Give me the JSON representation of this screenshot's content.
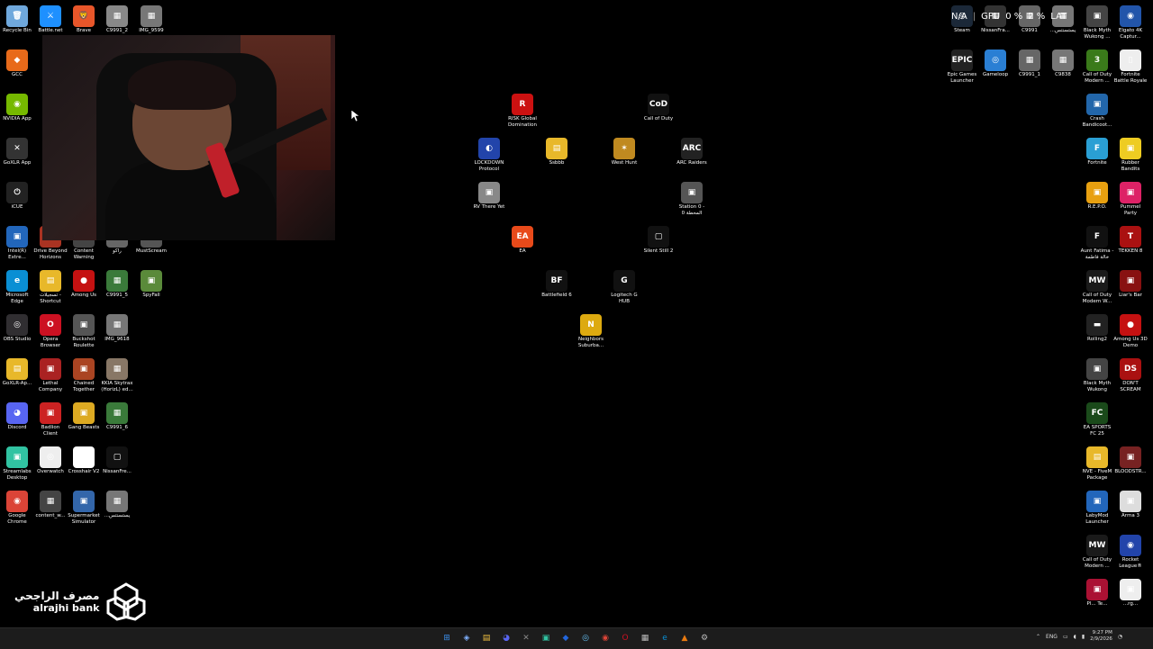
{
  "desktop": {
    "left_icons": [
      {
        "label": "Recycle Bin",
        "color": "#6fa8dc",
        "glyph": "🗑"
      },
      {
        "label": "Battle.net",
        "color": "#1e90ff",
        "glyph": "⚔"
      },
      {
        "label": "Brave",
        "color": "#e8562a",
        "glyph": "🦁"
      },
      {
        "label": "C9991_2",
        "color": "#888",
        "glyph": "▦"
      },
      {
        "label": "IMG_9599",
        "color": "#777",
        "glyph": "▦"
      },
      {
        "label": "GCC",
        "color": "#e86a1a",
        "glyph": "◆"
      },
      {
        "label": "NVIDIA App",
        "color": "#76b900",
        "glyph": "◉"
      },
      {
        "label": "GoXLR App",
        "color": "#333",
        "glyph": "✕"
      },
      {
        "label": "iCUE",
        "color": "#222",
        "glyph": "⏻"
      },
      {
        "label": "Intel(R) Extre...",
        "color": "#2266bb",
        "glyph": "▣"
      },
      {
        "label": "Drive Beyond Horizons",
        "color": "#aa3322",
        "glyph": "▣"
      },
      {
        "label": "Content Warning",
        "color": "#444",
        "glyph": "▣"
      },
      {
        "label": "راكو",
        "color": "#666",
        "glyph": "▣"
      },
      {
        "label": "MustScream",
        "color": "#555",
        "glyph": "▣"
      },
      {
        "label": "Microsoft Edge",
        "color": "#0a8fd4",
        "glyph": "e"
      },
      {
        "label": "تسجيلات - Shortcut",
        "color": "#e8b82a",
        "glyph": "▤"
      },
      {
        "label": "Among Us",
        "color": "#c51111",
        "glyph": "●"
      },
      {
        "label": "C9991_5",
        "color": "#3a7a3a",
        "glyph": "▦"
      },
      {
        "label": "SpyFall",
        "color": "#5a8a3a",
        "glyph": "▣"
      },
      {
        "label": "OBS Studio",
        "color": "#302e31",
        "glyph": "◎"
      },
      {
        "label": "Opera Browser",
        "color": "#cc1122",
        "glyph": "O"
      },
      {
        "label": "Buckshot Roulette",
        "color": "#555",
        "glyph": "▣"
      },
      {
        "label": "IMG_9618",
        "color": "#777",
        "glyph": "▦"
      },
      {
        "label": "GoXLR-Ap...",
        "color": "#e8b82a",
        "glyph": "▤"
      },
      {
        "label": "Lethal Company",
        "color": "#aa2222",
        "glyph": "▣"
      },
      {
        "label": "Chained Together",
        "color": "#aa4422",
        "glyph": "▣"
      },
      {
        "label": "KKIA Skytrax (HorizL) ed...",
        "color": "#887766",
        "glyph": "▦"
      },
      {
        "label": "Discord",
        "color": "#5865f2",
        "glyph": "◕"
      },
      {
        "label": "Badlion Client",
        "color": "#cc2222",
        "glyph": "▣"
      },
      {
        "label": "Gang Beasts",
        "color": "#ddaa22",
        "glyph": "▣"
      },
      {
        "label": "C9991_6",
        "color": "#3a7a3a",
        "glyph": "▦"
      },
      {
        "label": "Streamlabs Desktop",
        "color": "#31c3a2",
        "glyph": "▣"
      },
      {
        "label": "Overwatch",
        "color": "#eeeeee",
        "glyph": "◎"
      },
      {
        "label": "Crosshair V2",
        "color": "#ffffff",
        "glyph": "✛"
      },
      {
        "label": "NissanFre...",
        "color": "#111",
        "glyph": "▢"
      },
      {
        "label": "Google Chrome",
        "color": "#db4437",
        "glyph": "◉"
      },
      {
        "label": "content_w...",
        "color": "#444",
        "glyph": "▦"
      },
      {
        "label": "Supermarket Simulator",
        "color": "#3366aa",
        "glyph": "▣"
      },
      {
        "label": "...يستسنتس",
        "color": "#777",
        "glyph": "▦"
      }
    ],
    "center_icons": [
      {
        "label": "RISK Global Domination",
        "color": "#cc1111",
        "glyph": "R"
      },
      {
        "label": "Call of Duty",
        "color": "#111",
        "glyph": "CoD"
      },
      {
        "label": "LOCKDOWN Protocol",
        "color": "#2244aa",
        "glyph": "◐"
      },
      {
        "label": "Ssbbb",
        "color": "#e8b82a",
        "glyph": "▤"
      },
      {
        "label": "West Hunt",
        "color": "#c08a20",
        "glyph": "✶"
      },
      {
        "label": "ARC Raiders",
        "color": "#222",
        "glyph": "ARC"
      },
      {
        "label": "RV There Yet",
        "color": "#888",
        "glyph": "▣"
      },
      {
        "label": "Station 0 - المحطة 0",
        "color": "#555",
        "glyph": "▣"
      },
      {
        "label": "EA",
        "color": "#e84a1a",
        "glyph": "EA"
      },
      {
        "label": "Silent Still 2",
        "color": "#111",
        "glyph": "▢"
      },
      {
        "label": "Battlefield 6",
        "color": "#111",
        "glyph": "BF"
      },
      {
        "label": "Logitech G HUB",
        "color": "#111",
        "glyph": "G"
      },
      {
        "label": "Neighbors Suburba...",
        "color": "#ddaa10",
        "glyph": "N"
      }
    ],
    "right_icons": [
      {
        "label": "Steam",
        "color": "#1b2838",
        "glyph": "◎"
      },
      {
        "label": "NissanFra...",
        "color": "#333",
        "glyph": "▦"
      },
      {
        "label": "C9991",
        "color": "#666",
        "glyph": "▦"
      },
      {
        "label": "...يستسنتس",
        "color": "#777",
        "glyph": "▦"
      },
      {
        "label": "Black Myth Wukong ...",
        "color": "#444",
        "glyph": "▣"
      },
      {
        "label": "Elgato 4K Captur...",
        "color": "#2255aa",
        "glyph": "◉"
      },
      {
        "label": "Epic Games Launcher",
        "color": "#222",
        "glyph": "EPIC"
      },
      {
        "label": "Gameloop",
        "color": "#2a7fd4",
        "glyph": "◎"
      },
      {
        "label": "C9991_1",
        "color": "#666",
        "glyph": "▦"
      },
      {
        "label": "C9838",
        "color": "#777",
        "glyph": "▦"
      },
      {
        "label": "Call of Duty Modern ...",
        "color": "#3a7a1a",
        "glyph": "3"
      },
      {
        "label": "Fortnite Battle Royale",
        "color": "#eee",
        "glyph": "▯"
      },
      {
        "label": "Crash Bandicoot...",
        "color": "#2266aa",
        "glyph": "▣"
      },
      {
        "label": "Fortnite",
        "color": "#2a9fd4",
        "glyph": "F"
      },
      {
        "label": "Rubber Bandits",
        "color": "#eecc22",
        "glyph": "▣"
      },
      {
        "label": "R.E.P.O.",
        "color": "#e8a010",
        "glyph": "▣"
      },
      {
        "label": "Pummel Party",
        "color": "#dd2266",
        "glyph": "▣"
      },
      {
        "label": "Aunt Fatima - خالة فاطمة",
        "color": "#111",
        "glyph": "F"
      },
      {
        "label": "TEKKEN 8",
        "color": "#aa1111",
        "glyph": "T"
      },
      {
        "label": "Call of Duty Modern W...",
        "color": "#1a1a1a",
        "glyph": "MW"
      },
      {
        "label": "Liar's Bar",
        "color": "#881111",
        "glyph": "▣"
      },
      {
        "label": "Rolling2",
        "color": "#222",
        "glyph": "▬"
      },
      {
        "label": "Among Us 3D Demo",
        "color": "#c51111",
        "glyph": "●"
      },
      {
        "label": "Black Myth Wukong",
        "color": "#444",
        "glyph": "▣"
      },
      {
        "label": "DON'T SCREAM",
        "color": "#aa1111",
        "glyph": "DS"
      },
      {
        "label": "EA SPORTS FC 25",
        "color": "#1a4a1a",
        "glyph": "FC"
      },
      {
        "label": "NVE - FiveM Package",
        "color": "#e8b82a",
        "glyph": "▤"
      },
      {
        "label": "BLOODSTR...",
        "color": "#772222",
        "glyph": "▣"
      },
      {
        "label": "LabyMod Launcher",
        "color": "#2266bb",
        "glyph": "▣"
      },
      {
        "label": "Arma 3",
        "color": "#ddd",
        "glyph": "▣"
      },
      {
        "label": "Call of Duty Modern ...",
        "color": "#1a1a1a",
        "glyph": "MW"
      },
      {
        "label": "Rocket League®",
        "color": "#2244aa",
        "glyph": "◉"
      },
      {
        "label": "Pl... Te...",
        "color": "#aa1133",
        "glyph": "▣"
      },
      {
        "label": "...rg...",
        "color": "#eee",
        "glyph": "▣"
      }
    ]
  },
  "overlay": {
    "na": "N/A",
    "gpu_label": "GPU",
    "gpu_value": "0 %",
    "pct": "2 %",
    "lat": "LAT"
  },
  "bank": {
    "arabic": "مصرف الراجحي",
    "english": "alrajhi bank"
  },
  "taskbar": {
    "apps": [
      {
        "name": "windows-start",
        "glyph": "⊞",
        "color": "#3b8eea"
      },
      {
        "name": "copilot",
        "glyph": "◈",
        "color": "#7fb0ff"
      },
      {
        "name": "file-explorer",
        "glyph": "▤",
        "color": "#f2c040"
      },
      {
        "name": "discord",
        "glyph": "◕",
        "color": "#5865f2"
      },
      {
        "name": "goxlr",
        "glyph": "✕",
        "color": "#888"
      },
      {
        "name": "streamlabs",
        "glyph": "▣",
        "color": "#31c3a2"
      },
      {
        "name": "bluetooth-app",
        "glyph": "◆",
        "color": "#2266dd"
      },
      {
        "name": "steam",
        "glyph": "◎",
        "color": "#66c0f4"
      },
      {
        "name": "chrome",
        "glyph": "◉",
        "color": "#db4437"
      },
      {
        "name": "opera",
        "glyph": "O",
        "color": "#cc1122"
      },
      {
        "name": "apps-grid",
        "glyph": "▦",
        "color": "#bbb"
      },
      {
        "name": "edge",
        "glyph": "e",
        "color": "#0a8fd4"
      },
      {
        "name": "vlc-like",
        "glyph": "▲",
        "color": "#e87a10"
      },
      {
        "name": "settings",
        "glyph": "⚙",
        "color": "#bbb"
      }
    ],
    "lang": "ENG",
    "time": "9:27 PM",
    "date": "2/9/2026"
  }
}
